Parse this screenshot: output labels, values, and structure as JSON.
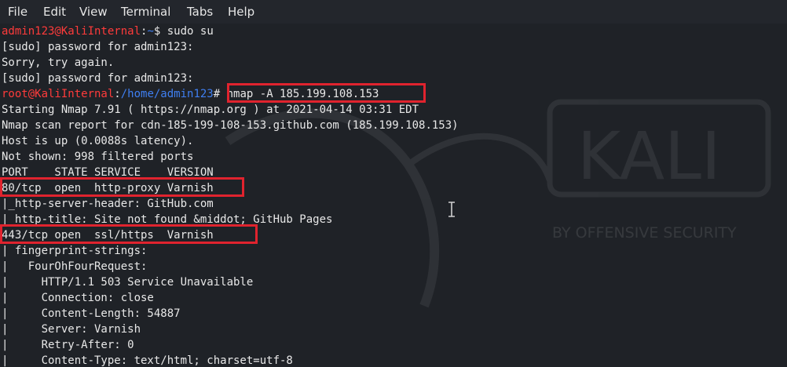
{
  "menu": [
    "File",
    "Edit",
    "View",
    "Terminal",
    "Tabs",
    "Help"
  ],
  "colors": {
    "prompt_user": "#ff3b3b",
    "prompt_path": "#3f7ff2",
    "text": "#e8e8e8",
    "highlight_box": "#e0232e",
    "background": "#1f2227"
  },
  "watermark": {
    "brand": "KALI",
    "tagline": "BY OFFENSIVE SECURITY"
  },
  "terminal": {
    "prompt1": {
      "user_host": "admin123@KaliInternal",
      "sep": ":",
      "path": "~",
      "symbol": "$",
      "command": " sudo su"
    },
    "sudo_prompt_1": "[sudo] password for admin123:",
    "sorry": "Sorry, try again.",
    "sudo_prompt_2": "[sudo] password for admin123:",
    "prompt2": {
      "user_host": "root@KaliInternal",
      "sep": ":",
      "path": "/home/admin123",
      "symbol": "#",
      "command": " nmap -A 185.199.108.153"
    },
    "output": [
      "Starting Nmap 7.91 ( https://nmap.org ) at 2021-04-14 03:31 EDT",
      "Nmap scan report for cdn-185-199-108-153.github.com (185.199.108.153)",
      "Host is up (0.0088s latency).",
      "Not shown: 998 filtered ports",
      "PORT    STATE SERVICE    VERSION",
      "80/tcp  open  http-proxy Varnish",
      "|_http-server-header: GitHub.com",
      "|_http-title: Site not found &middot; GitHub Pages",
      "443/tcp open  ssl/https  Varnish",
      "| fingerprint-strings:",
      "|   FourOhFourRequest:",
      "|     HTTP/1.1 503 Service Unavailable",
      "|     Connection: close",
      "|     Content-Length: 54887",
      "|     Server: Varnish",
      "|     Retry-After: 0",
      "|     Content-Type: text/html; charset=utf-8"
    ]
  }
}
